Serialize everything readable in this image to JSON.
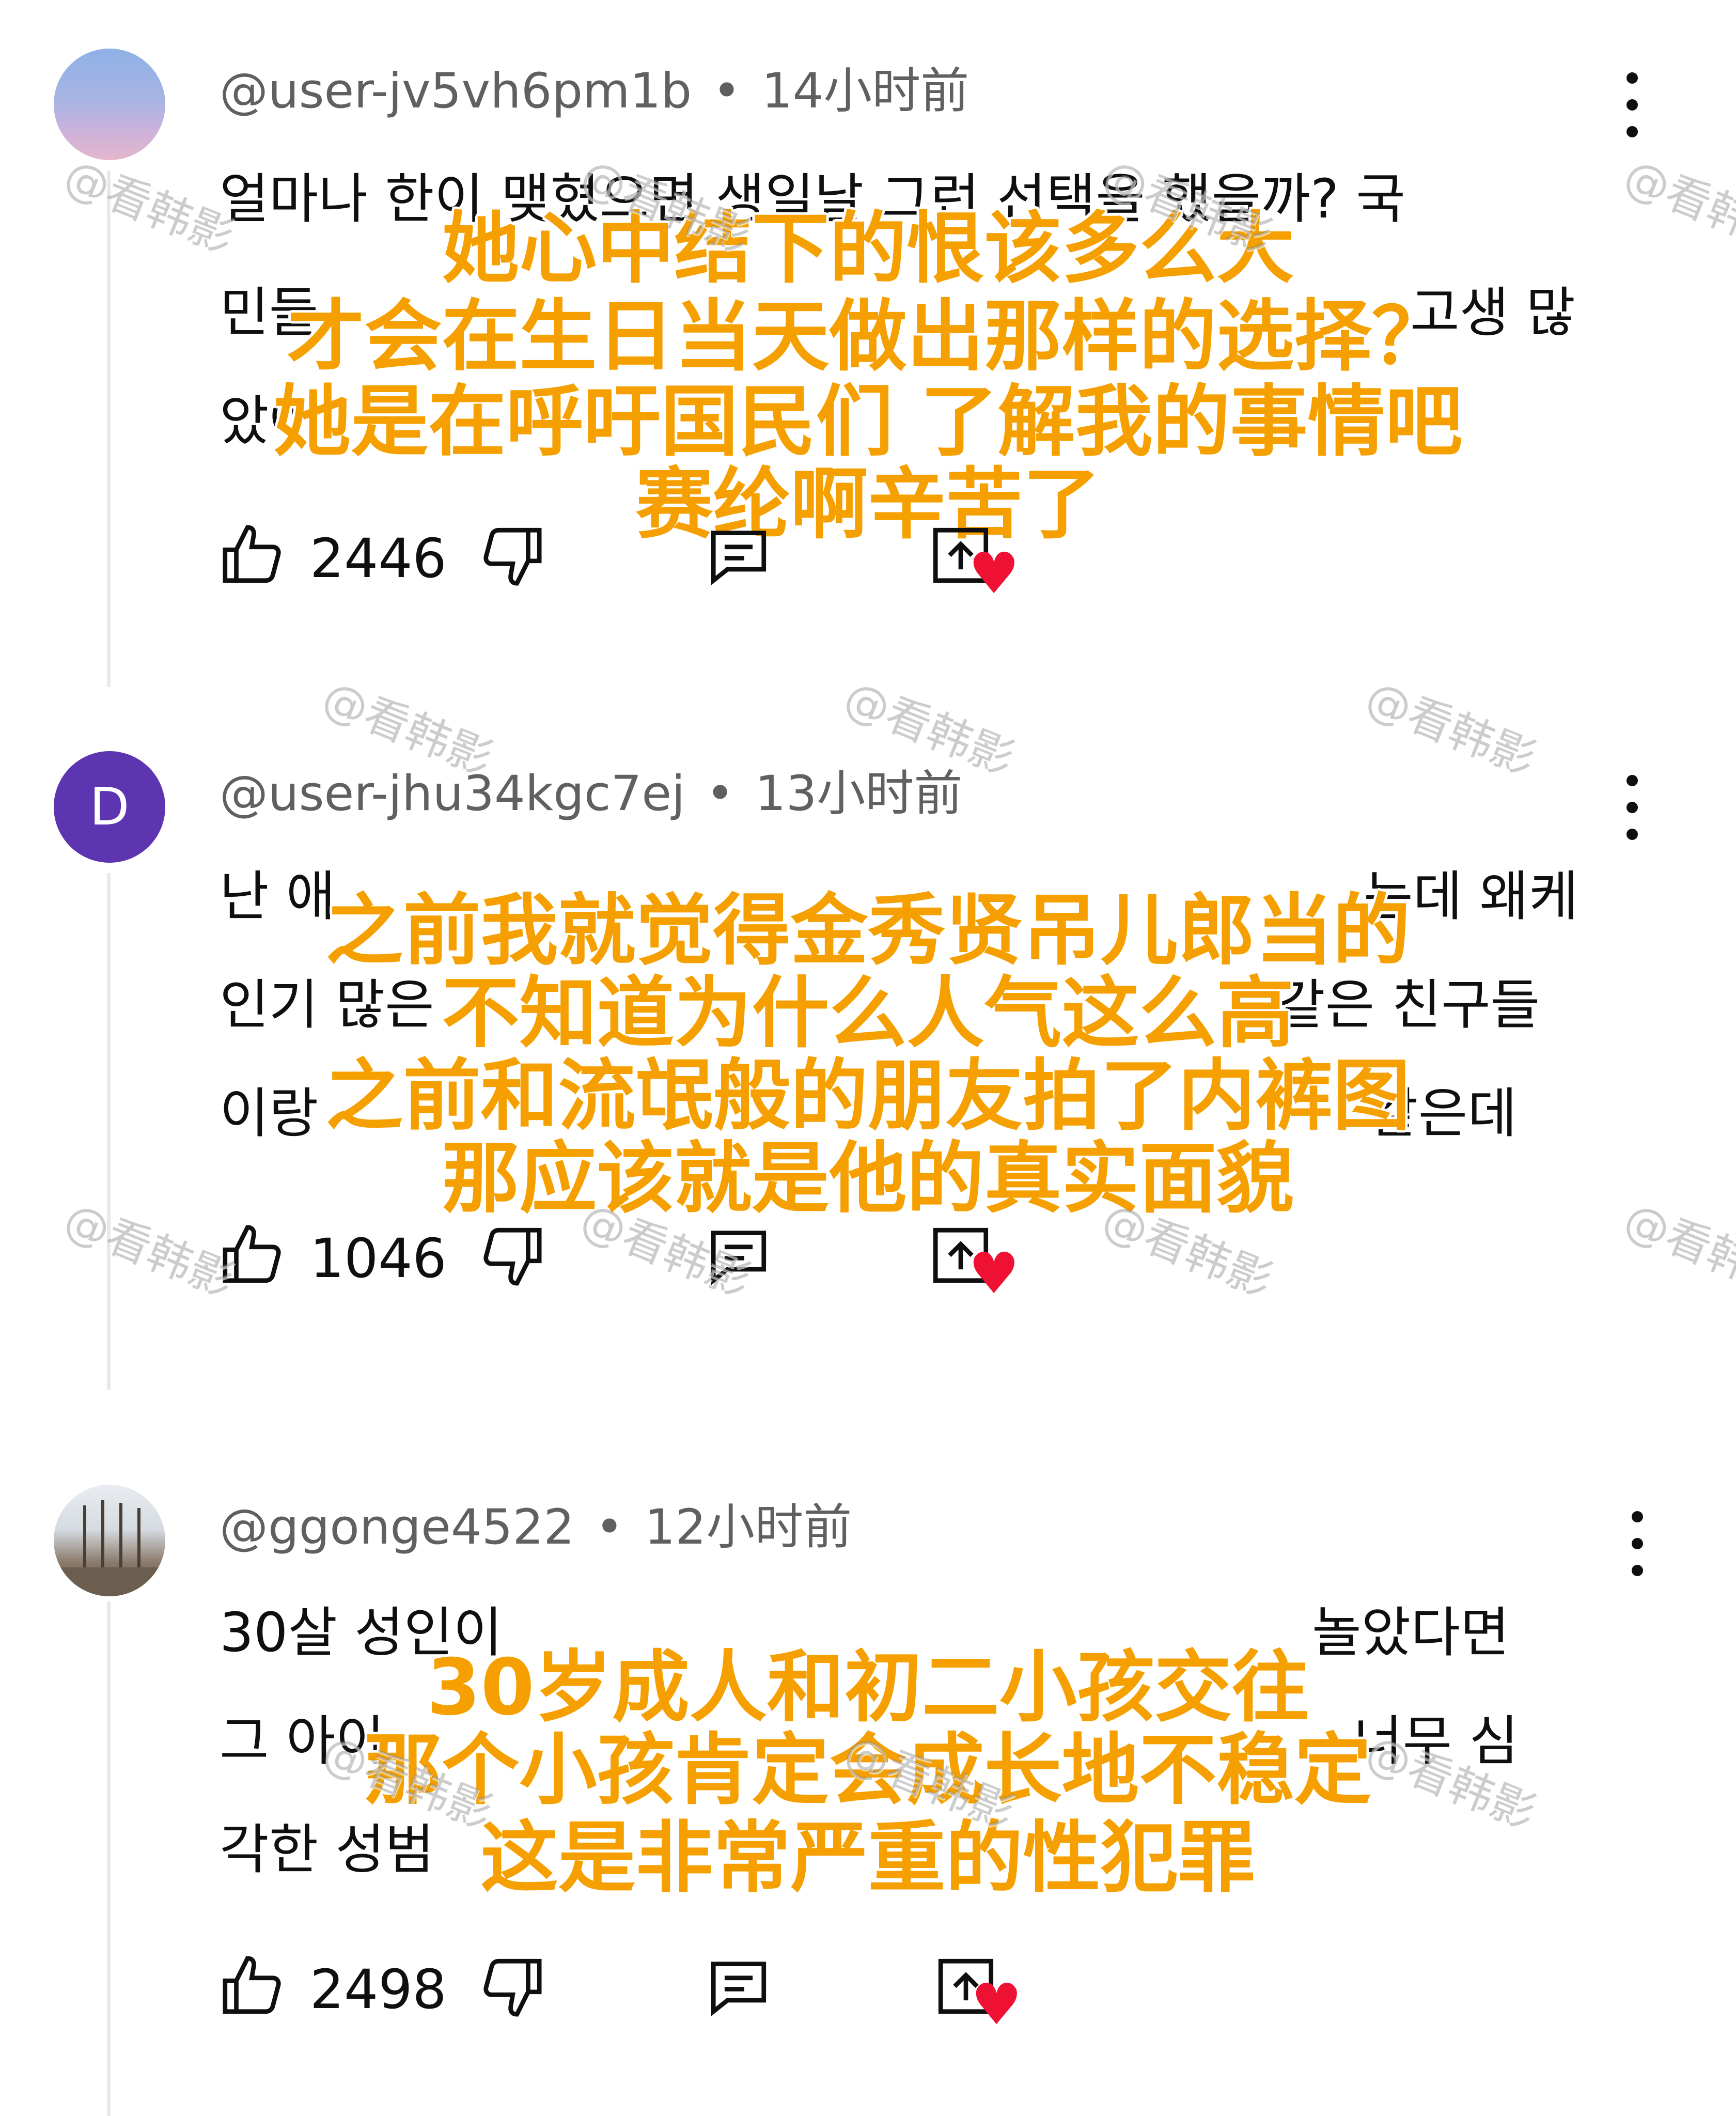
{
  "comments": [
    {
      "handle": "@user-jv5vh6pm1b",
      "time": "14小时前",
      "avatar_letter": "",
      "body_lines": [
        "얼마나 한이 맺혔으면 생일날 그런 선택을 했을까? 국",
        "민들",
        "았어"
      ],
      "overlay_lines": [
        "她心中结下的恨该多么大",
        "才会在生日当天做出那样的选择？",
        "她是在呼吁国民们 了解我的事情吧",
        "赛纶啊辛苦了"
      ],
      "likes": "2446"
    },
    {
      "handle": "@user-jhu34kgc7ej",
      "time": "13小时前",
      "avatar_letter": "D",
      "body_lines": [
        "난 애",
        "인기 많은",
        "이랑"
      ],
      "overlay_lines": [
        "之前我就觉得金秀贤吊儿郎当的",
        "不知道为什么人气这么高",
        "之前和流氓般的朋友拍了内裤图",
        "那应该就是他的真实面貌"
      ],
      "likes": "1046"
    },
    {
      "handle": "@ggonge4522",
      "time": "12小时前",
      "avatar_letter": "",
      "body_lines": [
        "30살 성인이",
        "그 아이",
        "각한 성범"
      ],
      "overlay_lines": [
        "30岁成人和初二小孩交往",
        "那个小孩肯定会成长地不稳定",
        "这是非常严重的性犯罪"
      ],
      "likes": "2498"
    }
  ],
  "body_fragments": {
    "c1_l2_right": "고생 많",
    "c2_l1_right": "는데 왜케",
    "c2_l2_right": "같은 친구들",
    "c2_l3_right": "같은데",
    "c3_l1_right": "놀았다면",
    "c3_l2_right": "너무 심"
  },
  "watermark": "@看韩影",
  "icons": {
    "like": "thumb-up-icon",
    "dislike": "thumb-down-icon",
    "reply": "reply-comment-icon",
    "share": "share-icon",
    "more": "more-vertical-icon",
    "heart": "heart-sticker-icon"
  },
  "colors": {
    "overlay_text": "#f5a000",
    "meta": "#606060",
    "heart": "#ee1133",
    "avatar_d": "#5e35b1"
  }
}
